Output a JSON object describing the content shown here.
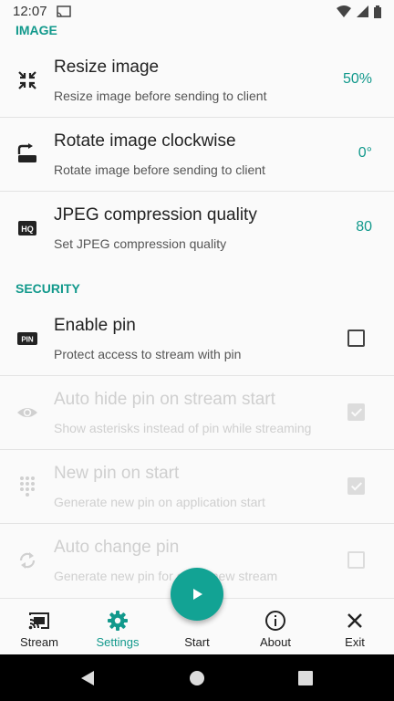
{
  "status_bar": {
    "time": "12:07"
  },
  "sections": {
    "image": "IMAGE",
    "security": "SECURITY"
  },
  "prefs": [
    {
      "title": "Resize image",
      "summary": "Resize image before sending to client",
      "value": "50%",
      "icon": "resize-icon",
      "enabled": true
    },
    {
      "title": "Rotate image clockwise",
      "summary": "Rotate image before sending to client",
      "value": "0°",
      "icon": "rotate-icon",
      "enabled": true
    },
    {
      "title": "JPEG compression quality",
      "summary": "Set JPEG compression quality",
      "value": "80",
      "icon": "hq-icon",
      "enabled": true
    },
    {
      "title": "Enable pin",
      "summary": "Protect access to stream with pin",
      "checked": false,
      "icon": "pin-icon",
      "enabled": true
    },
    {
      "title": "Auto hide pin on stream start",
      "summary": "Show asterisks instead of pin while streaming",
      "checked": true,
      "icon": "eye-icon",
      "enabled": false
    },
    {
      "title": "New pin on start",
      "summary": "Generate new pin on application start",
      "checked": true,
      "icon": "dialpad-icon",
      "enabled": false
    },
    {
      "title": "Auto change pin",
      "summary": "Generate new pin for every new stream",
      "checked": false,
      "icon": "refresh-icon",
      "enabled": false
    }
  ],
  "bottom_nav": {
    "items": [
      {
        "label": "Stream",
        "icon": "cast-icon"
      },
      {
        "label": "Settings",
        "icon": "gear-icon",
        "active": true
      },
      {
        "label": "Start",
        "icon": "play-icon"
      },
      {
        "label": "About",
        "icon": "info-icon"
      },
      {
        "label": "Exit",
        "icon": "close-icon"
      }
    ]
  },
  "colors": {
    "accent": "#12998c",
    "fab": "#12a394",
    "divider": "#e3e3e3",
    "disabled_text": "#cfcfcf"
  }
}
